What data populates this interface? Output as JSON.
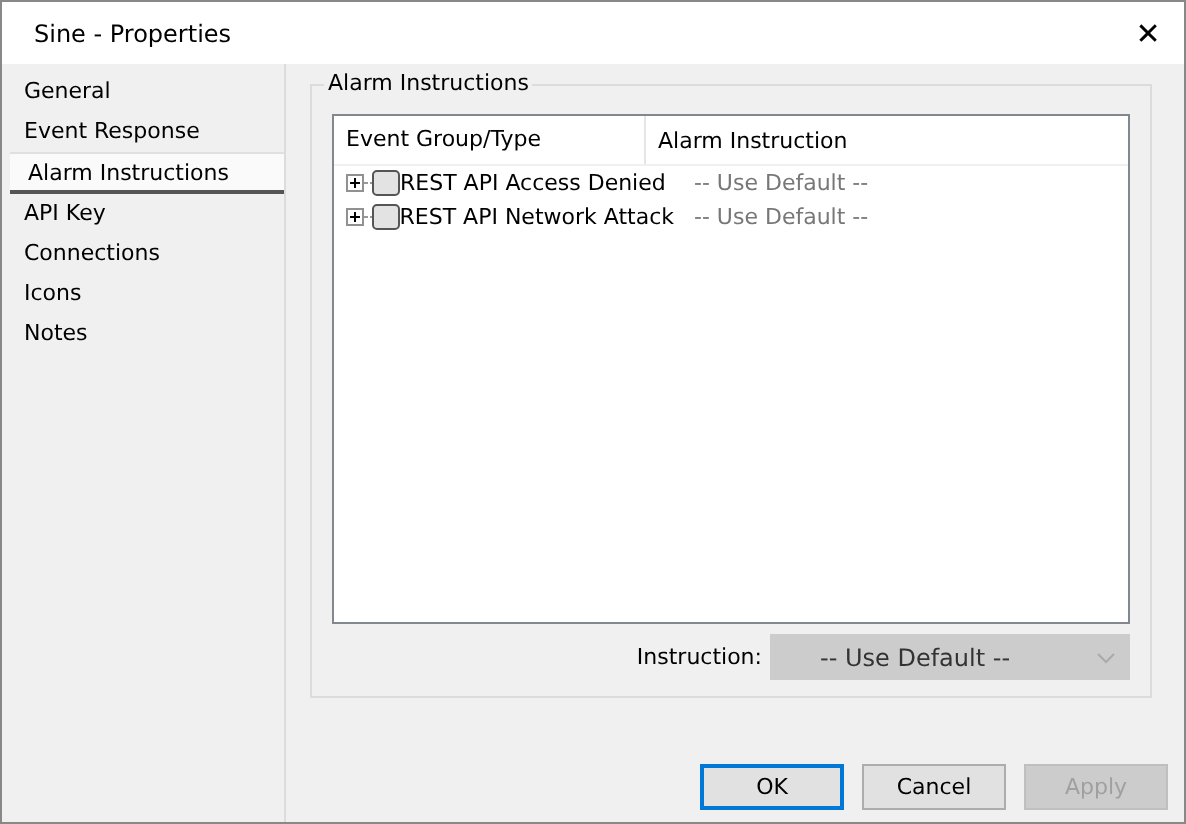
{
  "window": {
    "title": "Sine - Properties",
    "close": "✕"
  },
  "sidebar": {
    "items": [
      {
        "label": "General",
        "selected": false
      },
      {
        "label": "Event Response",
        "selected": false
      },
      {
        "label": "Alarm Instructions",
        "selected": true
      },
      {
        "label": "API Key",
        "selected": false
      },
      {
        "label": "Connections",
        "selected": false
      },
      {
        "label": "Icons",
        "selected": false
      },
      {
        "label": "Notes",
        "selected": false
      }
    ]
  },
  "group": {
    "title": "Alarm Instructions",
    "table": {
      "columns": [
        "Event Group/Type",
        "Alarm Instruction"
      ],
      "rows": [
        {
          "name": "REST API Access Denied",
          "instruction": "-- Use Default --",
          "expanded": false
        },
        {
          "name": "REST API Network Attack",
          "instruction": "-- Use Default --",
          "expanded": false
        }
      ]
    },
    "instruction": {
      "label": "Instruction:",
      "value": "-- Use Default --",
      "disabled": true
    }
  },
  "buttons": [
    {
      "label": "OK",
      "default": true,
      "disabled": false
    },
    {
      "label": "Cancel",
      "default": false,
      "disabled": false
    },
    {
      "label": "Apply",
      "default": false,
      "disabled": true
    }
  ]
}
